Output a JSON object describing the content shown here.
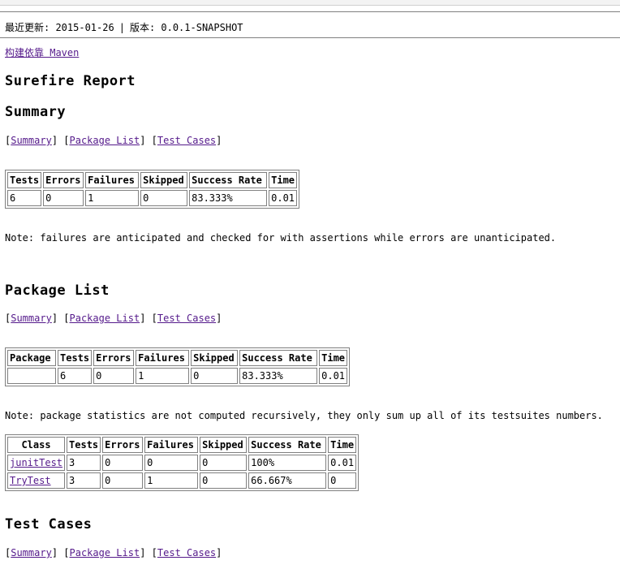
{
  "meta": {
    "last_updated_label": "最近更新: 2015-01-26",
    "separator": "|",
    "version_label": "版本: 0.0.1-SNAPSHOT"
  },
  "built_by_link": "构建依靠 Maven",
  "report_title": "Surefire Report",
  "nav": {
    "summary": "Summary",
    "package_list": "Package List",
    "test_cases": "Test Cases"
  },
  "summary": {
    "heading": "Summary",
    "columns": [
      "Tests",
      "Errors",
      "Failures",
      "Skipped",
      "Success Rate",
      "Time"
    ],
    "row": [
      "6",
      "0",
      "1",
      "0",
      "83.333%",
      "0.01"
    ],
    "note": "Note: failures are anticipated and checked for with assertions while errors are unanticipated."
  },
  "package_list": {
    "heading": "Package List",
    "columns": [
      "Package",
      "Tests",
      "Errors",
      "Failures",
      "Skipped",
      "Success Rate",
      "Time"
    ],
    "row": [
      "",
      "6",
      "0",
      "1",
      "0",
      "83.333%",
      "0.01"
    ],
    "note": "Note: package statistics are not computed recursively, they only sum up all of its testsuites numbers.",
    "class_table": {
      "columns": [
        "Class",
        "Tests",
        "Errors",
        "Failures",
        "Skipped",
        "Success Rate",
        "Time"
      ],
      "rows": [
        {
          "name": "junitTest",
          "tests": "3",
          "errors": "0",
          "failures": "0",
          "skipped": "0",
          "rate": "100%",
          "time": "0.01"
        },
        {
          "name": "TryTest",
          "tests": "3",
          "errors": "0",
          "failures": "1",
          "skipped": "0",
          "rate": "66.667%",
          "time": "0"
        }
      ]
    }
  },
  "test_cases": {
    "heading": "Test Cases"
  }
}
